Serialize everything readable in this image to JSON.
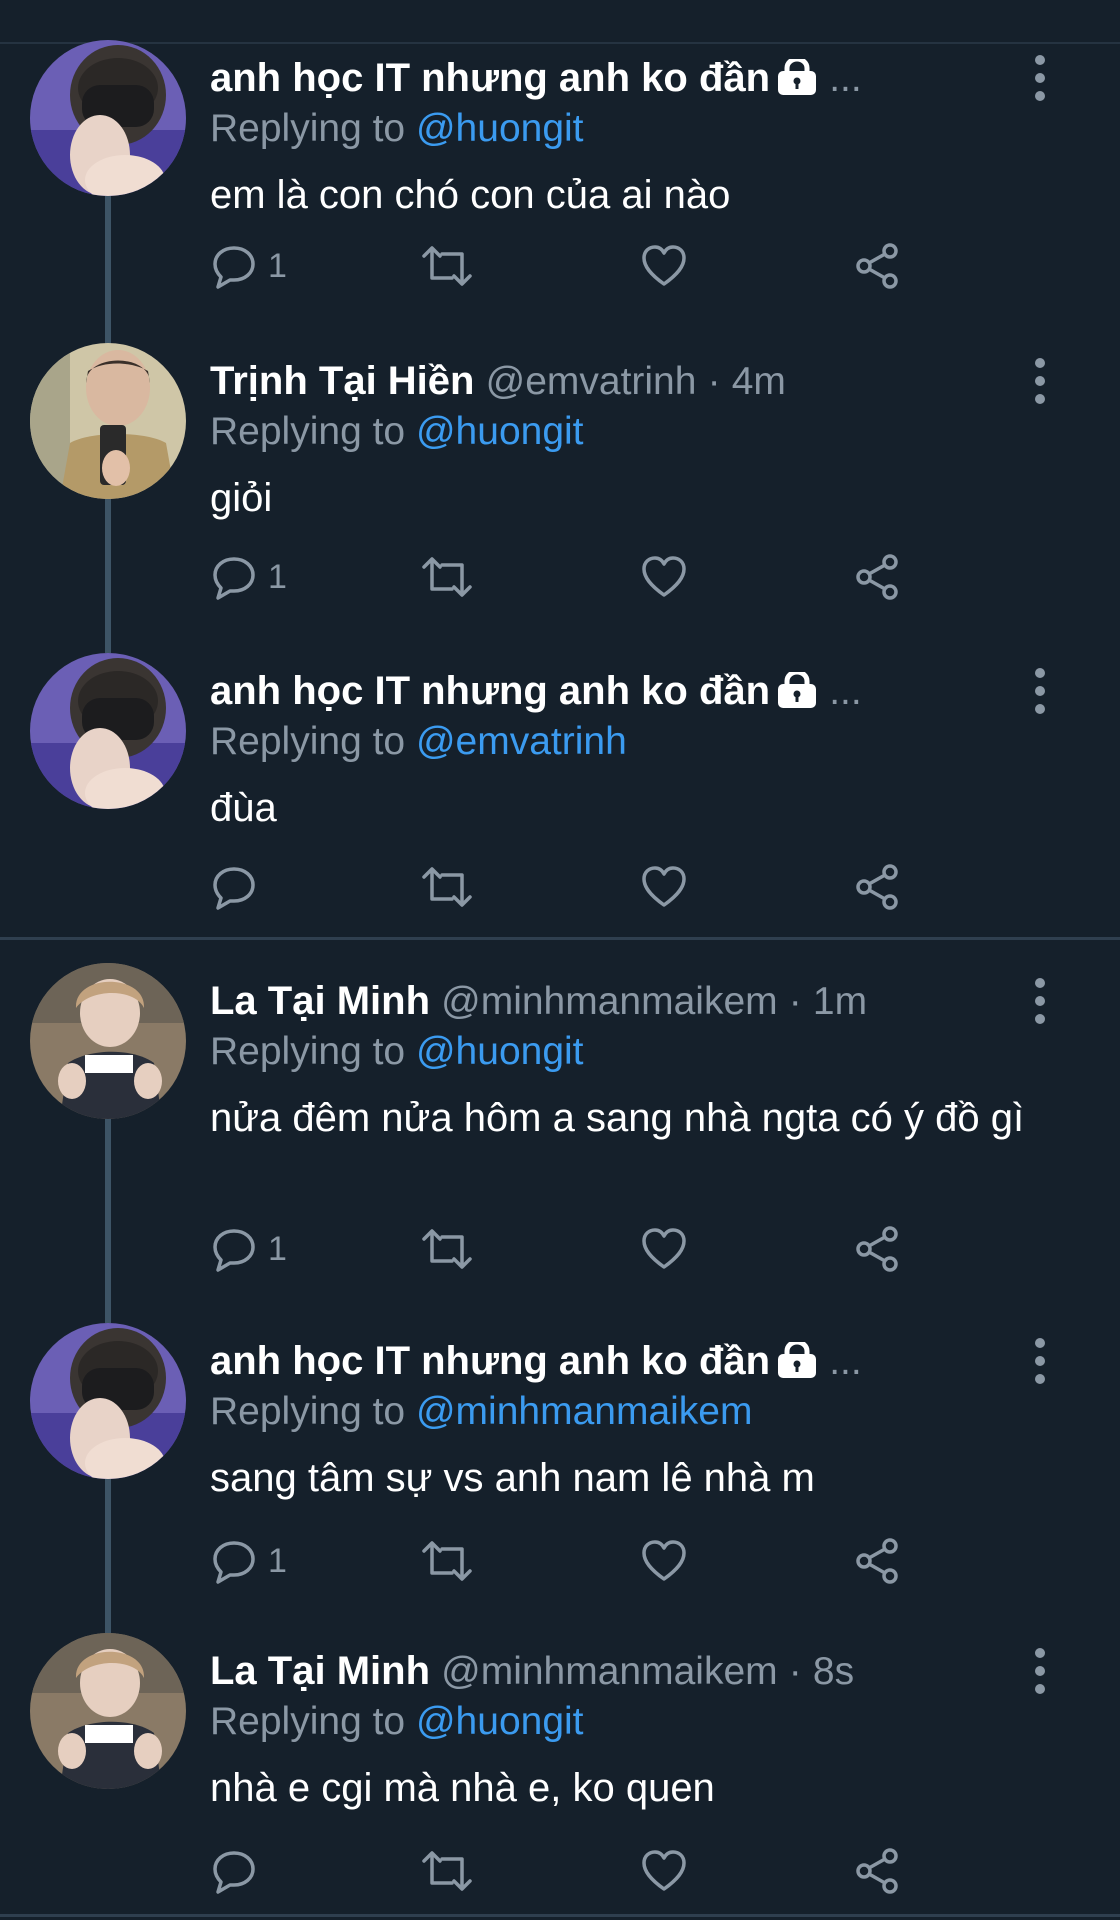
{
  "colors": {
    "background": "#15202b",
    "accent": "#3b9bf0",
    "muted": "#8b98a5",
    "thread_line": "#3d5466"
  },
  "tweets": [
    {
      "name": "anh học IT nhưng anh ko đần",
      "locked": true,
      "handle": "",
      "time": "",
      "ellipsis": "...",
      "replying_prefix": "Replying to",
      "replying_to": "@huongit",
      "text": "em là con chó con của ai nào",
      "reply_count": "1",
      "avatar": "avatar-masked-boy"
    },
    {
      "name": "Trịnh Tại Hiền",
      "locked": false,
      "handle": "@emvatrinh",
      "dot": "·",
      "time": "4m",
      "replying_prefix": "Replying to",
      "replying_to": "@huongit",
      "text": "giỏi",
      "reply_count": "1",
      "avatar": "avatar-mirror-selfie"
    },
    {
      "name": "anh học IT nhưng anh ko đần",
      "locked": true,
      "handle": "",
      "time": "",
      "ellipsis": "...",
      "replying_prefix": "Replying to",
      "replying_to": "@emvatrinh",
      "text": "đùa",
      "reply_count": "",
      "avatar": "avatar-masked-boy"
    },
    {
      "name": "La Tại Minh",
      "locked": false,
      "handle": "@minhmanmaikem",
      "dot": "·",
      "time": "1m",
      "replying_prefix": "Replying to",
      "replying_to": "@huongit",
      "text": "nửa đêm nửa hôm a sang nhà ngta có ý đồ gì",
      "reply_count": "1",
      "avatar": "avatar-thumbs-up"
    },
    {
      "name": "anh học IT nhưng anh ko đần",
      "locked": true,
      "handle": "",
      "time": "",
      "ellipsis": "...",
      "replying_prefix": "Replying to",
      "replying_to": "@minhmanmaikem",
      "text": "sang tâm sự vs anh nam lê nhà m",
      "reply_count": "1",
      "avatar": "avatar-masked-boy"
    },
    {
      "name": "La Tại Minh",
      "locked": false,
      "handle": "@minhmanmaikem",
      "dot": "·",
      "time": "8s",
      "replying_prefix": "Replying to",
      "replying_to": "@huongit",
      "text": "nhà e cgi mà nhà e, ko quen",
      "reply_count": "",
      "avatar": "avatar-thumbs-up"
    }
  ]
}
